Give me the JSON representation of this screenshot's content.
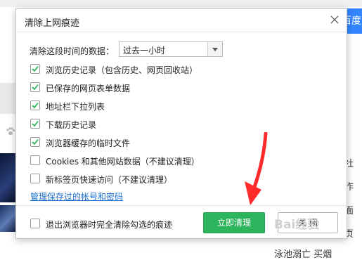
{
  "background": {
    "search_button_label": "百度",
    "right_texts": [
      "社",
      "作",
      "页",
      "面"
    ],
    "bottom_text": "泳池溺亡 买烟"
  },
  "dialog": {
    "title": "清除上网痕迹",
    "period": {
      "label": "清除这段时间的数据：",
      "selected": "过去一小时"
    },
    "options": [
      {
        "label": "浏览历史记录（包含历史、网页回收站）",
        "checked": true
      },
      {
        "label": "已保存的网页表单数据",
        "checked": true
      },
      {
        "label": "地址栏下拉列表",
        "checked": true
      },
      {
        "label": "下载历史记录",
        "checked": true
      },
      {
        "label": "浏览器缓存的临时文件",
        "checked": true
      },
      {
        "label": "Cookies 和其他网站数据（不建议清理）",
        "checked": false
      },
      {
        "label": "新标签页快速访问（不建议清理）",
        "checked": false
      }
    ],
    "manage_link": "管理保存过的帐号和密码",
    "exit_option": {
      "label": "退出浏览器时完全清除勾选的痕迹",
      "checked": false
    },
    "clean_button": "立即清理",
    "close_button": "关 闭"
  },
  "watermark": "Bai经验",
  "colors": {
    "clean_button": "#2db55d",
    "checkmark": "#2db55d",
    "link": "#1a6dcc",
    "annotation_arrow": "#ff2a2a"
  }
}
